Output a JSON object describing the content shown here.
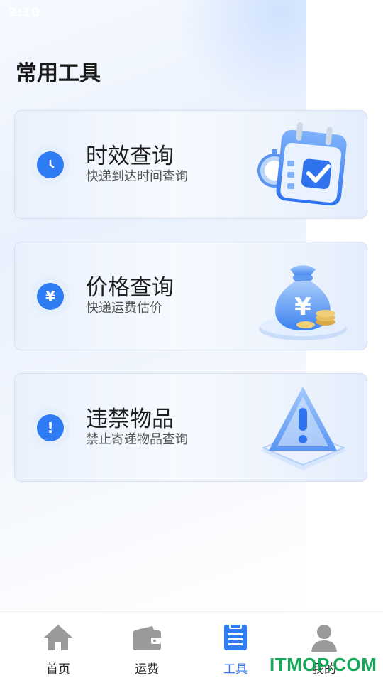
{
  "status_bar": {
    "time": "2:10"
  },
  "page": {
    "title": "常用工具"
  },
  "cards": [
    {
      "title": "时效查询",
      "subtitle": "快递到达时间查询",
      "icon": "clock-icon",
      "art": "calendar-check-illustration"
    },
    {
      "title": "价格查询",
      "subtitle": "快递运费估价",
      "icon": "yen-icon",
      "art": "money-bag-illustration"
    },
    {
      "title": "违禁物品",
      "subtitle": "禁止寄递物品查询",
      "icon": "exclamation-icon",
      "art": "warning-sign-illustration"
    }
  ],
  "tabbar": {
    "items": [
      {
        "label": "首页",
        "icon": "home-icon"
      },
      {
        "label": "运费",
        "icon": "wallet-icon"
      },
      {
        "label": "工具",
        "icon": "tools-icon",
        "active": true
      },
      {
        "label": "我的",
        "icon": "profile-icon"
      }
    ]
  },
  "watermark": "ITMOP.COM",
  "colors": {
    "accent": "#2f7cf5",
    "inactive_icon": "#9a9a9a",
    "watermark": "#17a65a"
  }
}
